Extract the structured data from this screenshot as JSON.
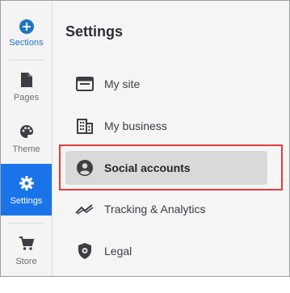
{
  "rail": {
    "items": [
      {
        "label": "Sections",
        "icon": "add-circle-icon"
      },
      {
        "label": "Pages",
        "icon": "page-icon"
      },
      {
        "label": "Theme",
        "icon": "palette-icon"
      },
      {
        "label": "Settings",
        "icon": "gear-icon"
      },
      {
        "label": "Store",
        "icon": "cart-icon"
      }
    ]
  },
  "panel": {
    "title": "Settings",
    "items": [
      {
        "label": "My site",
        "icon": "browser-window-icon"
      },
      {
        "label": "My business",
        "icon": "building-icon"
      },
      {
        "label": "Social accounts",
        "icon": "user-circle-icon"
      },
      {
        "label": "Tracking & Analytics",
        "icon": "trend-icon"
      },
      {
        "label": "Legal",
        "icon": "shield-icon"
      }
    ]
  },
  "colors": {
    "accent": "#1a73e8",
    "highlight_border": "#e23b3b",
    "selected_row": "#d9d9d9"
  }
}
